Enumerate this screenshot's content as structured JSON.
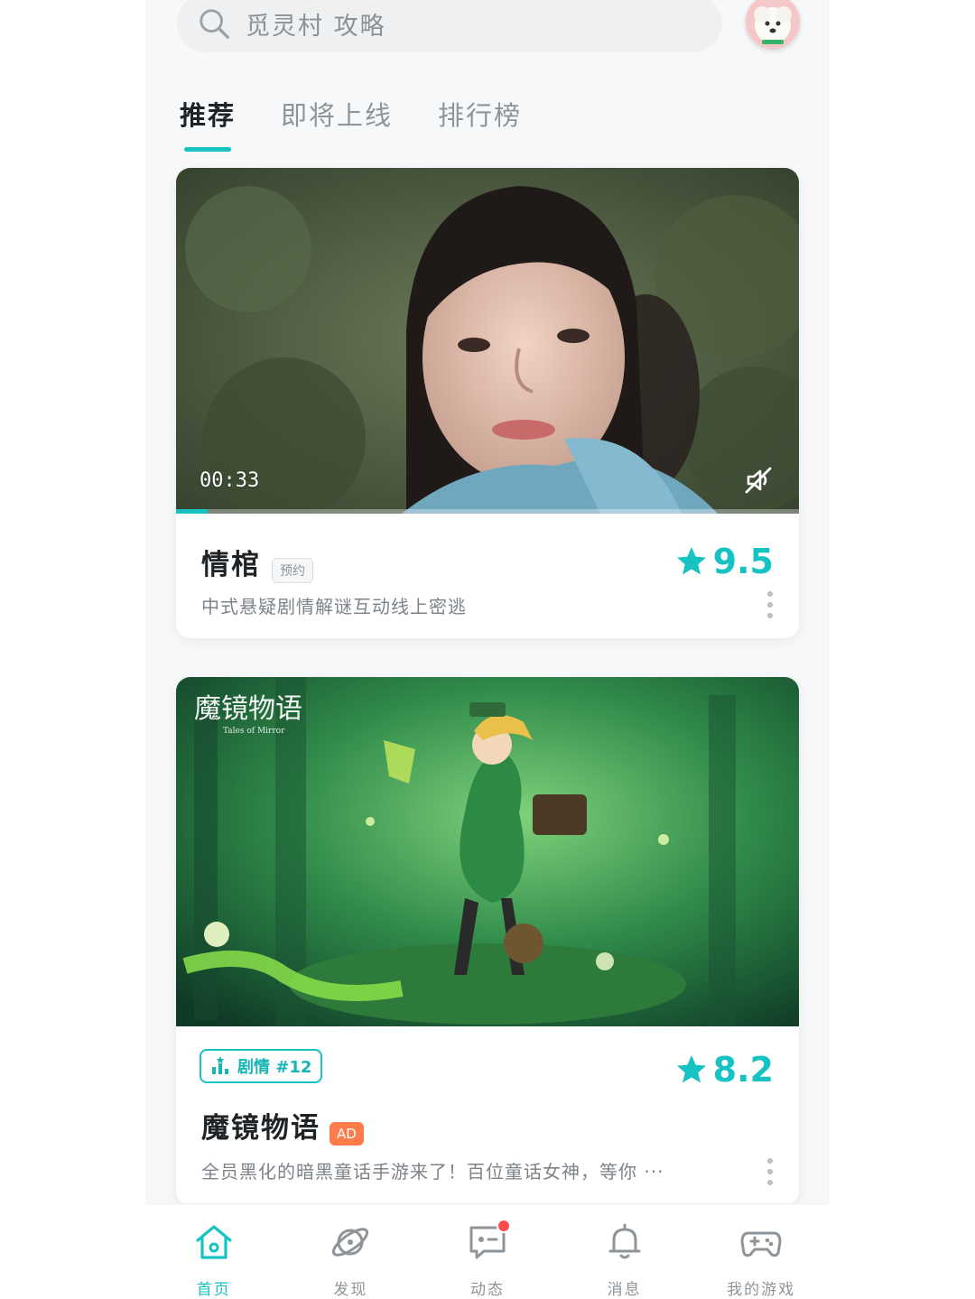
{
  "search": {
    "placeholder": "觅灵村 攻略"
  },
  "tabs": [
    {
      "label": "推荐",
      "active": true
    },
    {
      "label": "即将上线",
      "active": false
    },
    {
      "label": "排行榜",
      "active": false
    }
  ],
  "cards": [
    {
      "title": "情棺",
      "badge": "预约",
      "rating": "9.5",
      "description": "中式悬疑剧情解谜互动线上密逃",
      "video_time": "00:33",
      "video_progress": 0.05
    },
    {
      "title": "魔镜物语",
      "badge": "AD",
      "rating": "8.2",
      "rank_tag": "剧情 #12",
      "description": "全员黑化的暗黑童话手游来了！百位童话女神，等你 ···",
      "banner_logo": "魔镜物语",
      "banner_logo_sub": "Tales of Mirror"
    }
  ],
  "bottom_nav": [
    {
      "label": "首页",
      "icon": "home-icon",
      "active": true
    },
    {
      "label": "发现",
      "icon": "planet-icon",
      "active": false
    },
    {
      "label": "动态",
      "icon": "chat-icon",
      "active": false,
      "has_notification": true
    },
    {
      "label": "消息",
      "icon": "bell-icon",
      "active": false
    },
    {
      "label": "我的游戏",
      "icon": "gamepad-icon",
      "active": false
    }
  ],
  "colors": {
    "accent": "#16c2c2",
    "ad_badge": "#ff7c4a",
    "notification": "#ff4d4d"
  }
}
